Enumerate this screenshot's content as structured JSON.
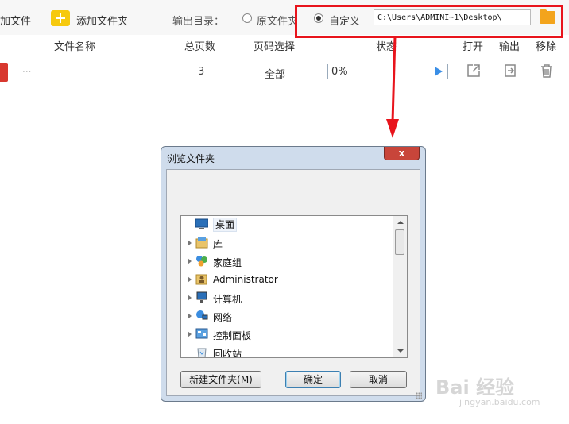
{
  "toolbar": {
    "add_file_label": "加文件",
    "add_folder_label": "添加文件夹",
    "output_dir_label": "输出目录：",
    "radio_original_label": "原文件夹",
    "radio_custom_label": "自定义",
    "output_path": "C:\\Users\\ADMINI~1\\Desktop\\",
    "selected_option": "自定义"
  },
  "columns": {
    "file_name": "文件名称",
    "total_pages": "总页数",
    "page_select": "页码选择",
    "status": "状态",
    "open": "打开",
    "output": "输出",
    "remove": "移除"
  },
  "file_row": {
    "name": "...",
    "total_pages": "3",
    "page_select": "全部",
    "progress_text": "0%",
    "progress_fraction": 0
  },
  "dialog": {
    "title": "浏览文件夹",
    "close_label": "x",
    "tree": [
      {
        "label": "桌面",
        "icon": "desktop-icon",
        "expandable": false,
        "selected": true
      },
      {
        "label": "库",
        "icon": "library-icon",
        "expandable": true,
        "selected": false
      },
      {
        "label": "家庭组",
        "icon": "homegroup-icon",
        "expandable": true,
        "selected": false
      },
      {
        "label": "Administrator",
        "icon": "user-folder-icon",
        "expandable": true,
        "selected": false
      },
      {
        "label": "计算机",
        "icon": "computer-icon",
        "expandable": true,
        "selected": false
      },
      {
        "label": "网络",
        "icon": "network-icon",
        "expandable": true,
        "selected": false
      },
      {
        "label": "控制面板",
        "icon": "control-panel-icon",
        "expandable": true,
        "selected": false
      },
      {
        "label": "回收站",
        "icon": "recycle-bin-icon",
        "expandable": false,
        "selected": false
      }
    ],
    "new_folder_button": "新建文件夹(M)",
    "ok_button": "确定",
    "cancel_button": "取消"
  },
  "colors": {
    "highlight_border": "#e8141c",
    "arrow": "#e8141c",
    "folder_icon": "#f3a41c",
    "progress_play": "#3a8ee6"
  },
  "watermark": {
    "brand": "Bai 经验",
    "url": "jingyan.baidu.com"
  }
}
